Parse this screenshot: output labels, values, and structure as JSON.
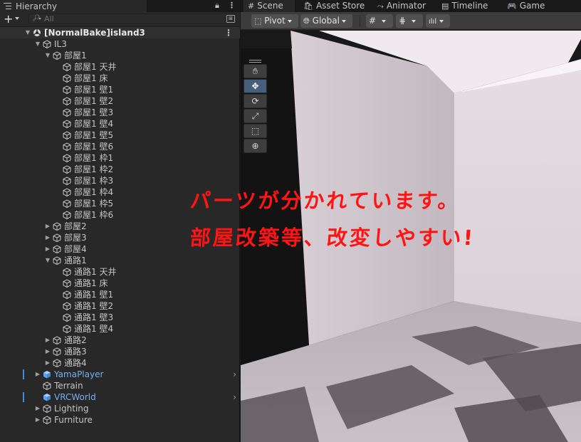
{
  "hierarchy": {
    "tab_label": "Hierarchy",
    "search_placeholder": "All",
    "add_label": "+",
    "rows": [
      {
        "label": "[NormalBake]island3",
        "depth": 0,
        "arrow": "▼",
        "icon": "unity-scene-icon",
        "bold": true
      },
      {
        "label": "IL3",
        "depth": 1,
        "arrow": "▼"
      },
      {
        "label": "部屋1",
        "depth": 2,
        "arrow": "▼"
      },
      {
        "label": "部屋1 天井",
        "depth": 3
      },
      {
        "label": "部屋1 床",
        "depth": 3
      },
      {
        "label": "部屋1 壁1",
        "depth": 3
      },
      {
        "label": "部屋1 壁2",
        "depth": 3
      },
      {
        "label": "部屋1 壁3",
        "depth": 3
      },
      {
        "label": "部屋1 壁4",
        "depth": 3
      },
      {
        "label": "部屋1 壁5",
        "depth": 3
      },
      {
        "label": "部屋1 壁6",
        "depth": 3
      },
      {
        "label": "部屋1 枠1",
        "depth": 3
      },
      {
        "label": "部屋1 枠2",
        "depth": 3
      },
      {
        "label": "部屋1 枠3",
        "depth": 3
      },
      {
        "label": "部屋1 枠4",
        "depth": 3
      },
      {
        "label": "部屋1 枠5",
        "depth": 3
      },
      {
        "label": "部屋1 枠6",
        "depth": 3
      },
      {
        "label": "部屋2",
        "depth": 2,
        "arrow": "▶"
      },
      {
        "label": "部屋3",
        "depth": 2,
        "arrow": "▶"
      },
      {
        "label": "部屋4",
        "depth": 2,
        "arrow": "▶"
      },
      {
        "label": "通路1",
        "depth": 2,
        "arrow": "▼"
      },
      {
        "label": "通路1 天井",
        "depth": 3
      },
      {
        "label": "通路1 床",
        "depth": 3
      },
      {
        "label": "通路1 壁1",
        "depth": 3
      },
      {
        "label": "通路1 壁2",
        "depth": 3
      },
      {
        "label": "通路1 壁3",
        "depth": 3
      },
      {
        "label": "通路1 壁4",
        "depth": 3
      },
      {
        "label": "通路2",
        "depth": 2,
        "arrow": "▶"
      },
      {
        "label": "通路3",
        "depth": 2,
        "arrow": "▶"
      },
      {
        "label": "通路4",
        "depth": 2,
        "arrow": "▶"
      },
      {
        "label": "YamaPlayer",
        "depth": 1,
        "arrow": "▶",
        "prefab": true
      },
      {
        "label": "Terrain",
        "depth": 1
      },
      {
        "label": "VRCWorld",
        "depth": 1,
        "prefab": true
      },
      {
        "label": "Lighting",
        "depth": 1,
        "arrow": "▶"
      },
      {
        "label": "Furniture",
        "depth": 1,
        "arrow": "▶"
      }
    ]
  },
  "scene": {
    "tabs": [
      {
        "label": "Scene",
        "icon": "grid-icon",
        "glyph": "#"
      },
      {
        "label": "Asset Store",
        "icon": "shopping-bag-icon",
        "glyph": "🛍"
      },
      {
        "label": "Animator",
        "icon": "animator-icon",
        "glyph": "⤳"
      },
      {
        "label": "Timeline",
        "icon": "timeline-icon",
        "glyph": "▤"
      },
      {
        "label": "Game",
        "icon": "gamepad-icon",
        "glyph": "🎮"
      }
    ],
    "pivot_label": "Pivot",
    "global_label": "Global"
  },
  "overlay_text": {
    "line1": "パーツが分かれています。",
    "line2": "部屋改築等、改変しやすい!"
  },
  "colors": {
    "accent_blue": "#76aff0",
    "overlay_red": "#ff1414",
    "active_tool": "#46607c"
  }
}
